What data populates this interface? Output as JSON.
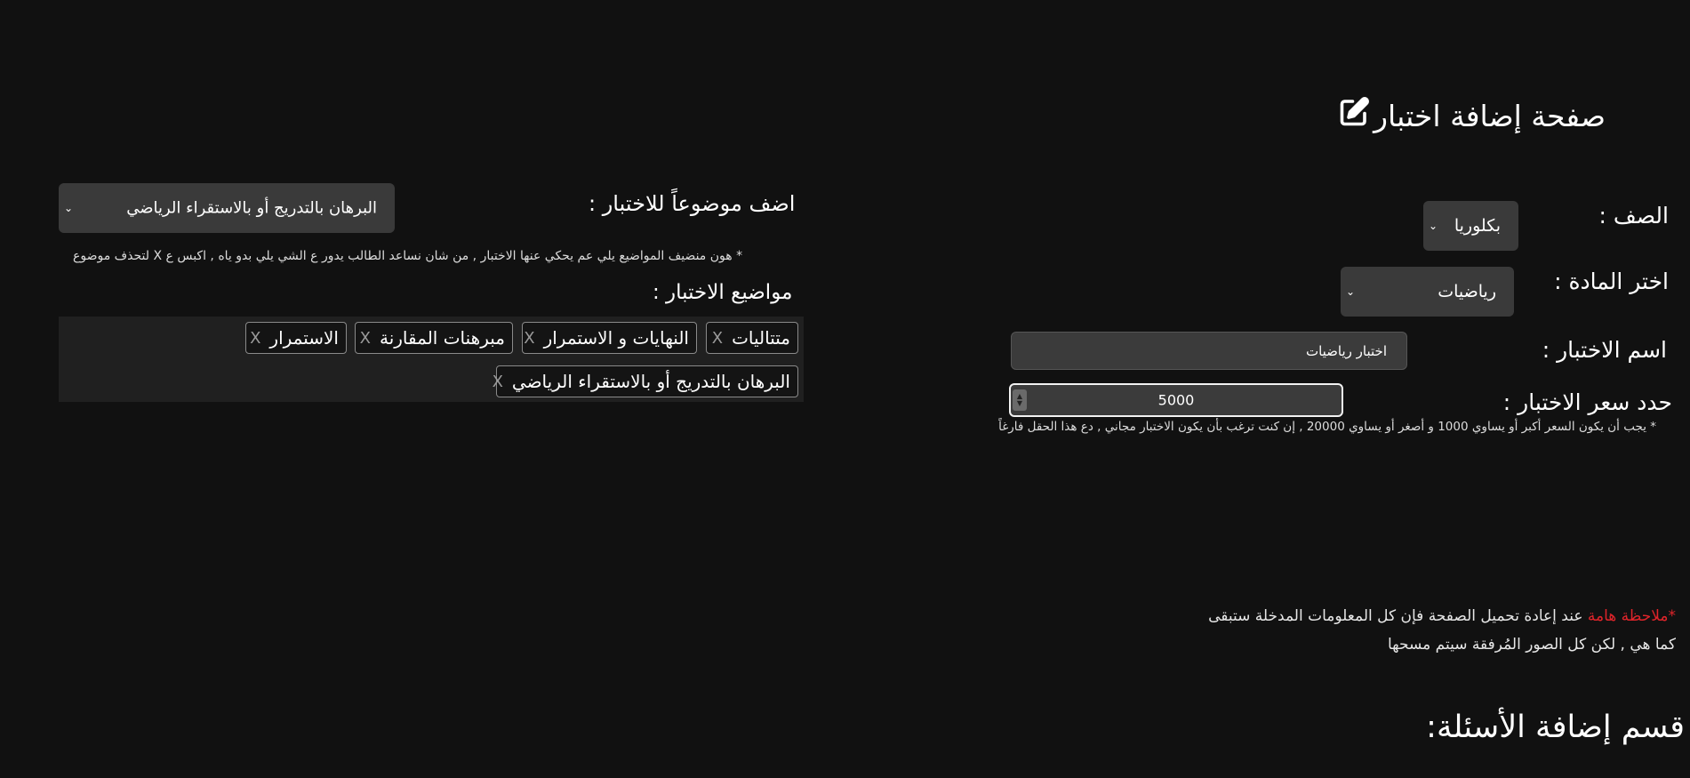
{
  "page_title": "صفحة إضافة اختبار",
  "form": {
    "grade_label": "الصف :",
    "grade_value": "بكلوريا",
    "subject_label": "اختر المادة :",
    "subject_value": "رياضيات",
    "exam_name_label": "اسم الاختبار :",
    "exam_name_value": "اختبار رياضيات",
    "price_label": "حدد سعر الاختبار :",
    "price_value": "5000",
    "price_hint": "* يجب أن يكون السعر أكبر أو يساوي 1000 و أصغر أو يساوي 20000 , إن كنت ترغب بأن يكون الاختبار مجاني , دع هذا الحقل فارغاً"
  },
  "topics": {
    "add_label": "اضف موضوعاً للاختبار :",
    "select_value": "البرهان بالتدريج أو بالاستقراء الرياضي",
    "hint": "* هون منضيف المواضيع يلي عم يحكي عنها الاختبار , من شان نساعد الطالب يدور ع الشي يلي بدو ياه , اكبس ع X لتحذف موضوع",
    "list_label": "مواضيع الاختبار :",
    "remove_symbol": "X",
    "chips": [
      "متتاليات",
      "النهايات و الاستمرار",
      "مبرهنات المقارنة",
      "الاستمرار",
      "البرهان بالتدريج أو بالاستقراء الرياضي"
    ]
  },
  "note": {
    "marker": "*",
    "important": "ملاحظة هامة",
    "line1_rest": " عند إعادة تحميل الصفحة فإن كل المعلومات المدخلة ستبقى",
    "line2": "كما هي , لكن كل الصور المُرفقة سيتم مسحها"
  },
  "questions_section_title": "قسم إضافة الأسئلة:"
}
